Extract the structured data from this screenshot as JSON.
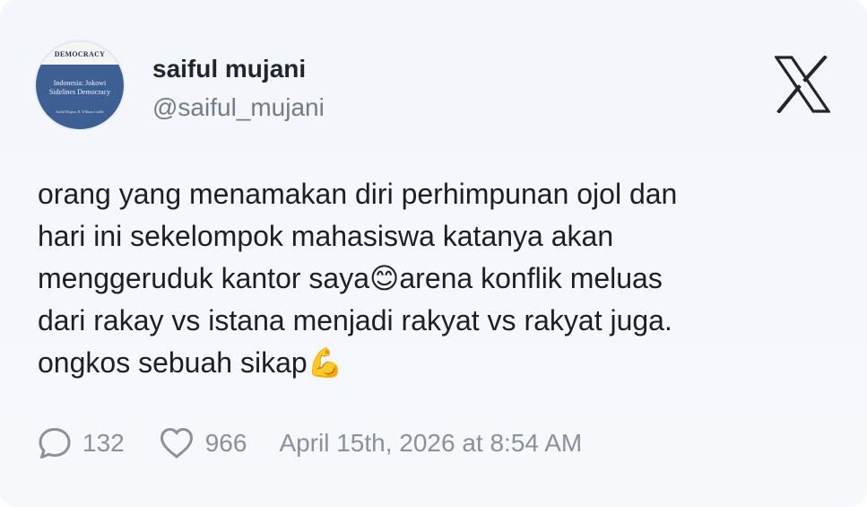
{
  "author": {
    "name": "saiful mujani",
    "handle": "@saiful_mujani",
    "avatar": {
      "brand": "DEMOCRACY",
      "title": "Indonesia: Jokowi\nSidelines Democracy",
      "subtitle": "Saiful Mujani, R. William Liddle"
    }
  },
  "tweet": {
    "text": "orang yang menamakan diri perhimpunan ojol dan\nhari ini sekelompok mahasiswa katanya akan\nmenggeruduk kantor saya😊arena konflik meluas\ndari rakay vs istana menjadi rakyat vs rakyat juga.\nongkos sebuah sikap💪"
  },
  "metrics": {
    "replies": "132",
    "likes": "966",
    "timestamp": "April 15th, 2026 at 8:54 AM"
  },
  "icons": {
    "platform": "x-logo-icon",
    "reply": "speech-bubble-icon",
    "like": "heart-icon"
  },
  "colors": {
    "background": "#f4f7fb",
    "text": "#1c1f24",
    "muted": "#8a909c",
    "avatar": "#3e5f93"
  }
}
